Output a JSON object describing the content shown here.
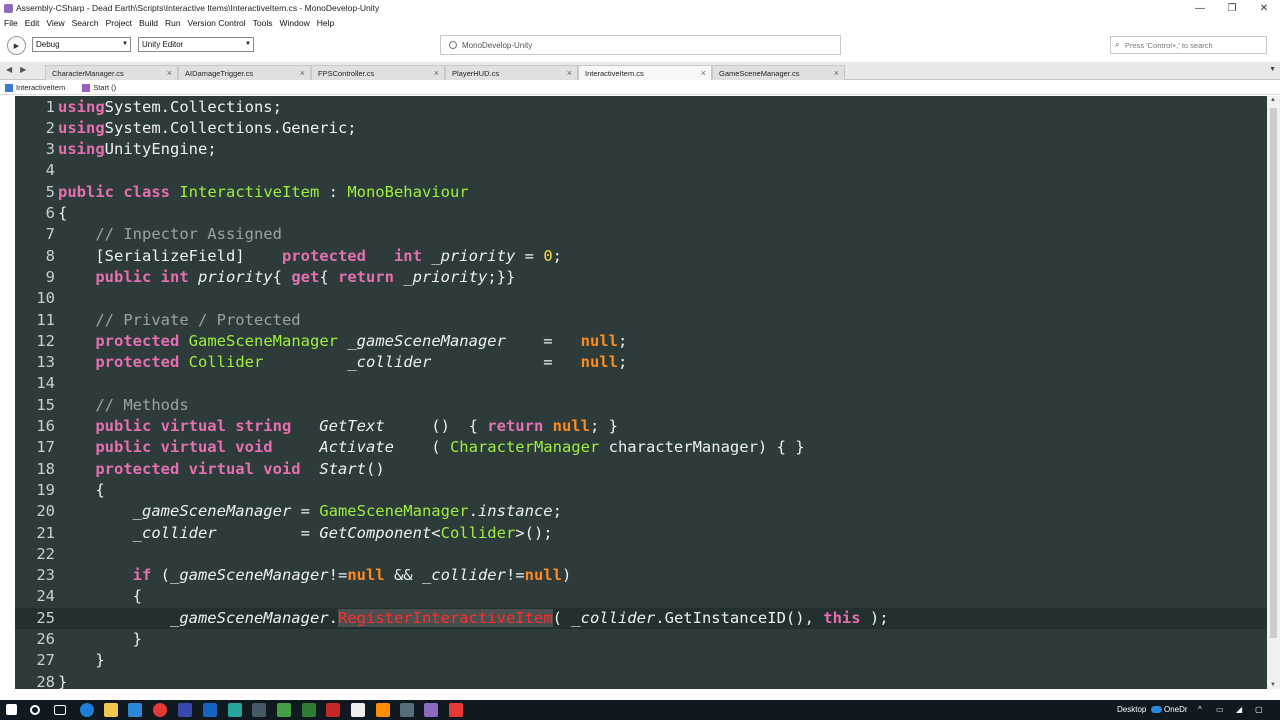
{
  "window": {
    "title": "Assembly-CSharp - Dead Earth\\Scripts\\Interactive Items\\InteractiveItem.cs - MonoDevelop-Unity",
    "minimize": "—",
    "maximize": "❐",
    "close": "✕"
  },
  "menu": [
    "File",
    "Edit",
    "View",
    "Search",
    "Project",
    "Build",
    "Run",
    "Version Control",
    "Tools",
    "Window",
    "Help"
  ],
  "toolbar": {
    "configuration": "Debug",
    "target": "Unity Editor",
    "status": "MonoDevelop-Unity",
    "search_placeholder": "Press 'Control+,' to search"
  },
  "tabs": [
    {
      "label": "CharacterManager.cs",
      "active": false
    },
    {
      "label": "AIDamageTrigger.cs",
      "active": false
    },
    {
      "label": "FPSController.cs",
      "active": false
    },
    {
      "label": "PlayerHUD.cs",
      "active": false
    },
    {
      "label": "InteractiveItem.cs",
      "active": true
    },
    {
      "label": "GameSceneManager.cs",
      "active": false
    }
  ],
  "breadcrumb": {
    "class": "InteractiveItem",
    "member": "Start ()"
  },
  "editor": {
    "current_line": 25,
    "lines": [
      {
        "n": "1",
        "tokens": [
          [
            "kw",
            "using"
          ],
          [
            "",
            "System.Collections;"
          ]
        ]
      },
      {
        "n": "2",
        "tokens": [
          [
            "kw",
            "using"
          ],
          [
            "",
            "System.Collections.Generic;"
          ]
        ]
      },
      {
        "n": "3",
        "tokens": [
          [
            "kw",
            "using"
          ],
          [
            "",
            "UnityEngine;"
          ]
        ]
      },
      {
        "n": "4",
        "tokens": []
      },
      {
        "n": "5",
        "tokens": [
          [
            "kw",
            "public class "
          ],
          [
            "ty",
            "InteractiveItem"
          ],
          [
            "",
            " : "
          ],
          [
            "ty",
            "MonoBehaviour"
          ]
        ]
      },
      {
        "n": "6",
        "tokens": [
          [
            "",
            "{"
          ]
        ]
      },
      {
        "n": "7",
        "tokens": [
          [
            "",
            "    "
          ],
          [
            "cm",
            "// Inpector Assigned"
          ]
        ]
      },
      {
        "n": "8",
        "tokens": [
          [
            "",
            "    [SerializeField]    "
          ],
          [
            "kw",
            "protected"
          ],
          [
            "",
            "   "
          ],
          [
            "kw",
            "int"
          ],
          [
            "",
            " "
          ],
          [
            "it",
            "_priority"
          ],
          [
            "",
            " = "
          ],
          [
            "num",
            "0"
          ],
          [
            "",
            ";"
          ]
        ]
      },
      {
        "n": "9",
        "tokens": [
          [
            "",
            "    "
          ],
          [
            "kw",
            "public int "
          ],
          [
            "it",
            "priority"
          ],
          [
            "",
            "{ "
          ],
          [
            "kw",
            "get"
          ],
          [
            "",
            "{ "
          ],
          [
            "kw",
            "return"
          ],
          [
            "",
            " "
          ],
          [
            "it",
            "_priority"
          ],
          [
            "",
            ";}}"
          ]
        ]
      },
      {
        "n": "10",
        "tokens": []
      },
      {
        "n": "11",
        "tokens": [
          [
            "",
            "    "
          ],
          [
            "cm",
            "// Private / Protected"
          ]
        ]
      },
      {
        "n": "12",
        "tokens": [
          [
            "",
            "    "
          ],
          [
            "kw",
            "protected"
          ],
          [
            "",
            " "
          ],
          [
            "ty",
            "GameSceneManager"
          ],
          [
            "",
            " "
          ],
          [
            "it",
            "_gameSceneManager"
          ],
          [
            "",
            "    =   "
          ],
          [
            "nl",
            "null"
          ],
          [
            "",
            ";"
          ]
        ]
      },
      {
        "n": "13",
        "tokens": [
          [
            "",
            "    "
          ],
          [
            "kw",
            "protected"
          ],
          [
            "",
            " "
          ],
          [
            "ty",
            "Collider"
          ],
          [
            "",
            "         "
          ],
          [
            "it",
            "_collider"
          ],
          [
            "",
            "            =   "
          ],
          [
            "nl",
            "null"
          ],
          [
            "",
            ";"
          ]
        ]
      },
      {
        "n": "14",
        "tokens": []
      },
      {
        "n": "15",
        "tokens": [
          [
            "",
            "    "
          ],
          [
            "cm",
            "// Methods"
          ]
        ]
      },
      {
        "n": "16",
        "tokens": [
          [
            "",
            "    "
          ],
          [
            "kw",
            "public virtual string"
          ],
          [
            "",
            "   "
          ],
          [
            "it",
            "GetText"
          ],
          [
            "",
            "     ()  { "
          ],
          [
            "kw",
            "return"
          ],
          [
            "",
            " "
          ],
          [
            "nl",
            "null"
          ],
          [
            "",
            "; }"
          ]
        ]
      },
      {
        "n": "17",
        "tokens": [
          [
            "",
            "    "
          ],
          [
            "kw",
            "public virtual void"
          ],
          [
            "",
            "     "
          ],
          [
            "it",
            "Activate"
          ],
          [
            "",
            "    ( "
          ],
          [
            "ty",
            "CharacterManager"
          ],
          [
            "",
            " characterManager) { }"
          ]
        ]
      },
      {
        "n": "18",
        "tokens": [
          [
            "",
            "    "
          ],
          [
            "kw",
            "protected virtual void"
          ],
          [
            "",
            "  "
          ],
          [
            "it",
            "Start"
          ],
          [
            "",
            "()"
          ]
        ]
      },
      {
        "n": "19",
        "tokens": [
          [
            "",
            "    {"
          ]
        ]
      },
      {
        "n": "20",
        "tokens": [
          [
            "",
            "        "
          ],
          [
            "it",
            "_gameSceneManager"
          ],
          [
            "",
            " = "
          ],
          [
            "ty",
            "GameSceneManager"
          ],
          [
            "",
            "."
          ],
          [
            "it",
            "instance"
          ],
          [
            "",
            ";"
          ]
        ]
      },
      {
        "n": "21",
        "tokens": [
          [
            "",
            "        "
          ],
          [
            "it",
            "_collider"
          ],
          [
            "",
            "         = "
          ],
          [
            "it",
            "GetComponent"
          ],
          [
            "",
            "<"
          ],
          [
            "ty",
            "Collider"
          ],
          [
            "",
            ">();"
          ]
        ]
      },
      {
        "n": "22",
        "tokens": []
      },
      {
        "n": "23",
        "tokens": [
          [
            "",
            "        "
          ],
          [
            "kw",
            "if"
          ],
          [
            "",
            " ("
          ],
          [
            "it",
            "_gameSceneManager"
          ],
          [
            "",
            "!="
          ],
          [
            "nl",
            "null"
          ],
          [
            "",
            " && "
          ],
          [
            "it",
            "_collider"
          ],
          [
            "",
            "!="
          ],
          [
            "nl",
            "null"
          ],
          [
            "",
            ")"
          ]
        ]
      },
      {
        "n": "24",
        "tokens": [
          [
            "",
            "        {"
          ]
        ]
      },
      {
        "n": "25",
        "tokens": [
          [
            "",
            "            "
          ],
          [
            "it",
            "_gameSceneManager"
          ],
          [
            "",
            "."
          ],
          [
            "err",
            "RegisterInteractiveItem"
          ],
          [
            "",
            "( "
          ],
          [
            "it",
            "_collider"
          ],
          [
            "",
            ".GetInstanceID(), "
          ],
          [
            "kw",
            "this"
          ],
          [
            "",
            " );"
          ]
        ]
      },
      {
        "n": "26",
        "tokens": [
          [
            "",
            "        }"
          ]
        ]
      },
      {
        "n": "27",
        "tokens": [
          [
            "",
            "    }"
          ]
        ]
      },
      {
        "n": "28",
        "tokens": [
          [
            "",
            "}"
          ]
        ]
      }
    ]
  },
  "taskbar": {
    "desktop_label": "Desktop",
    "onedrive_label": "OneDr",
    "colors": {
      "bg": "#101820",
      "editor_bg": "#2d3b3b",
      "keyword": "#e56fb1",
      "type": "#9fef3d",
      "null": "#ff8a1d"
    }
  }
}
